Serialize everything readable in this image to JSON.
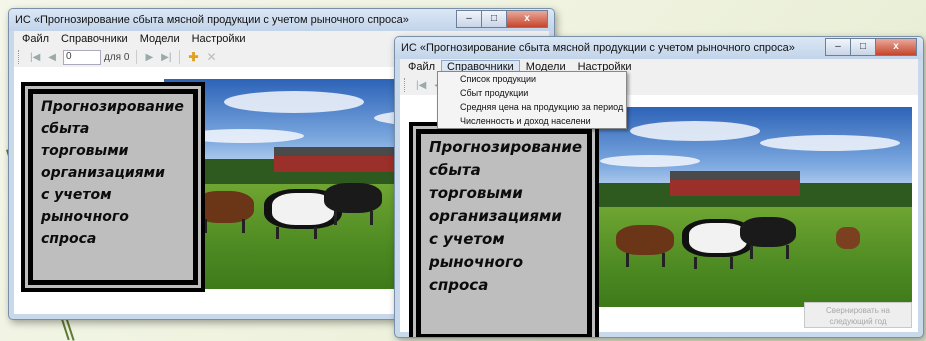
{
  "app": {
    "title": "ИС «Прогнозирование сбыта мясной продукции с учетом рыночного спроса»",
    "window_buttons": {
      "minimize": "–",
      "maximize": "□",
      "close": "x"
    }
  },
  "menu": [
    "Файл",
    "Справочники",
    "Модели",
    "Настройки"
  ],
  "toolbar": {
    "position_value": "0",
    "of_label": "для 0"
  },
  "textbox_text": "Прогнозирование\nсбыта\nторговыми\nорганизациями\nс учетом\nрыночного\nспроса",
  "dropdown": {
    "open_menu": "Справочники",
    "items": [
      "Список продукции",
      "Сбыт продукции",
      "Средняя цена на продукцию за период",
      "Численность и доход населени"
    ]
  },
  "forecast_button": "Свернировать на следующий год",
  "colors": {
    "titlebar": "#c9d9ec",
    "close": "#c6452c",
    "textbox": "#bebebe"
  }
}
